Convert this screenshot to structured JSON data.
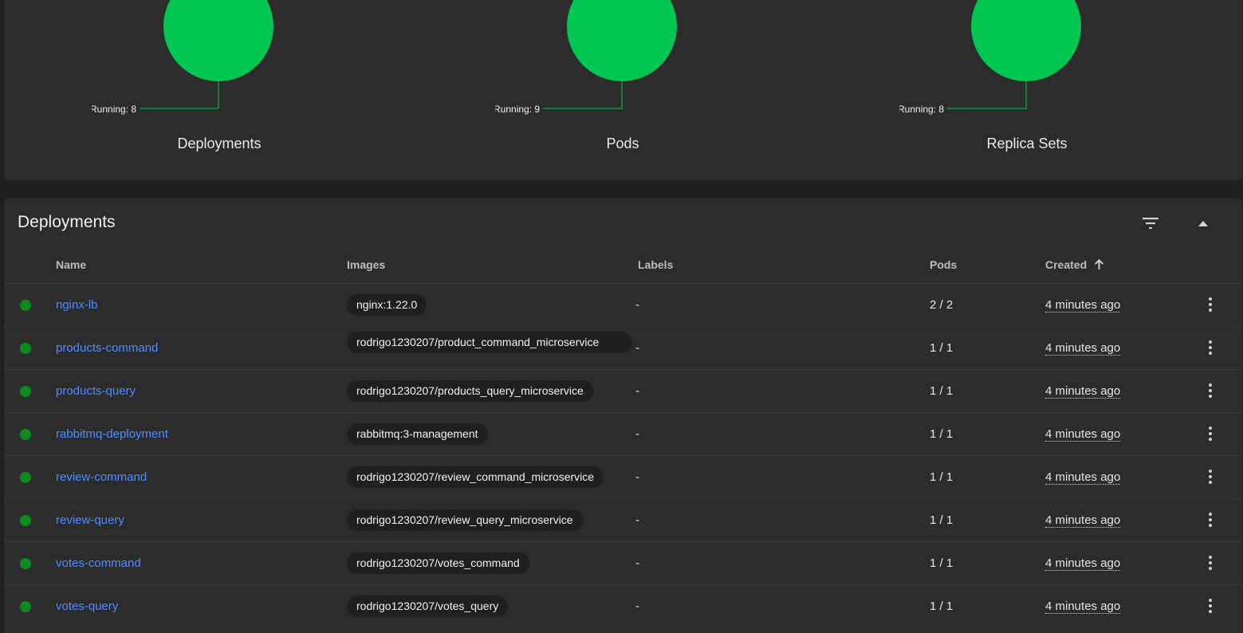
{
  "workload_status": {
    "charts": [
      {
        "title": "Deployments",
        "running_label": "Running: 8",
        "running": 8
      },
      {
        "title": "Pods",
        "running_label": "Running: 9",
        "running": 9
      },
      {
        "title": "Replica Sets",
        "running_label": "Running: 8",
        "running": 8
      }
    ],
    "running_color": "#00c752"
  },
  "deployments": {
    "title": "Deployments",
    "columns": {
      "name": "Name",
      "images": "Images",
      "labels": "Labels",
      "pods": "Pods",
      "created": "Created"
    },
    "sort_column": "Created",
    "sort_direction": "ascending",
    "icons": {
      "filter": "filter-icon",
      "collapse": "collapse-up-icon",
      "row_menu": "more-vert-icon"
    },
    "status_color": "#0d8a1e",
    "link_color": "#4f8cff",
    "rows": [
      {
        "name": "nginx-lb",
        "image": "nginx:1.22.0",
        "labels": "-",
        "pods": "2 / 2",
        "created": "4 minutes ago"
      },
      {
        "name": "products-command",
        "image": "rodrigo1230207/product_command_microservice",
        "labels": "-",
        "pods": "1 / 1",
        "created": "4 minutes ago"
      },
      {
        "name": "products-query",
        "image": "rodrigo1230207/products_query_microservice",
        "labels": "-",
        "pods": "1 / 1",
        "created": "4 minutes ago"
      },
      {
        "name": "rabbitmq-deployment",
        "image": "rabbitmq:3-management",
        "labels": "-",
        "pods": "1 / 1",
        "created": "4 minutes ago"
      },
      {
        "name": "review-command",
        "image": "rodrigo1230207/review_command_microservice",
        "labels": "-",
        "pods": "1 / 1",
        "created": "4 minutes ago"
      },
      {
        "name": "review-query",
        "image": "rodrigo1230207/review_query_microservice",
        "labels": "-",
        "pods": "1 / 1",
        "created": "4 minutes ago"
      },
      {
        "name": "votes-command",
        "image": "rodrigo1230207/votes_command",
        "labels": "-",
        "pods": "1 / 1",
        "created": "4 minutes ago"
      },
      {
        "name": "votes-query",
        "image": "rodrigo1230207/votes_query",
        "labels": "-",
        "pods": "1 / 1",
        "created": "4 minutes ago"
      }
    ]
  }
}
